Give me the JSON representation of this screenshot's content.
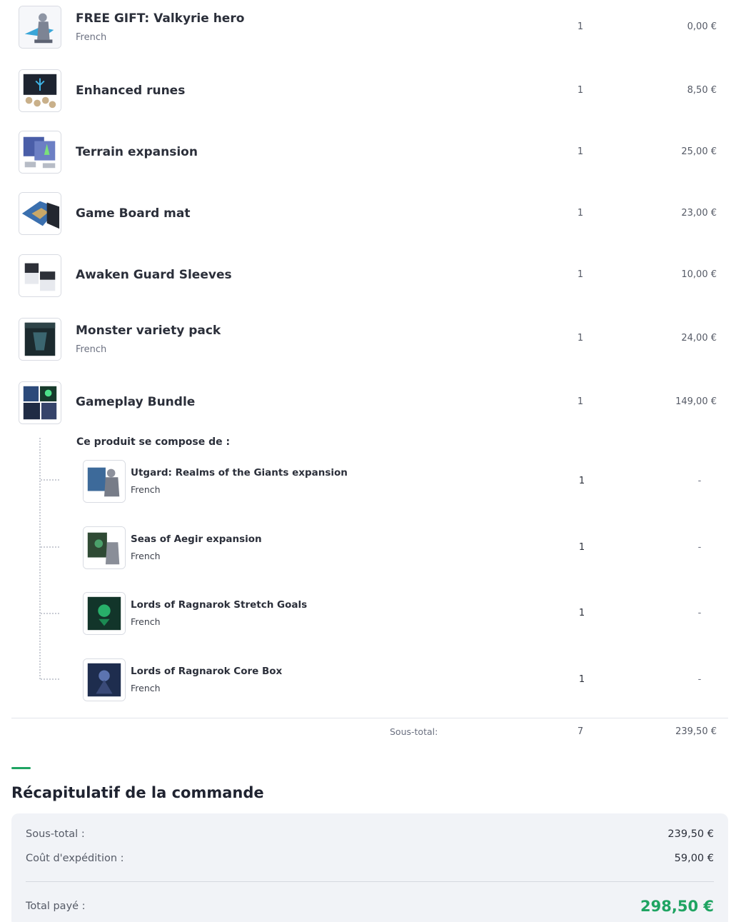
{
  "items": [
    {
      "name": "FREE GIFT: Valkyrie hero",
      "sub": "French",
      "qty": "1",
      "price": "0,00 €",
      "icon": "valkyrie-figure-icon"
    },
    {
      "name": "Enhanced runes",
      "sub": "",
      "qty": "1",
      "price": "8,50 €",
      "icon": "runes-box-icon"
    },
    {
      "name": "Terrain expansion",
      "sub": "",
      "qty": "1",
      "price": "25,00 €",
      "icon": "terrain-box-icon"
    },
    {
      "name": "Game Board mat",
      "sub": "",
      "qty": "1",
      "price": "23,00 €",
      "icon": "board-mat-icon"
    },
    {
      "name": "Awaken Guard Sleeves",
      "sub": "",
      "qty": "1",
      "price": "10,00 €",
      "icon": "sleeves-icon"
    },
    {
      "name": "Monster variety pack",
      "sub": "French",
      "qty": "1",
      "price": "24,00 €",
      "icon": "monster-box-icon"
    },
    {
      "name": "Gameplay Bundle",
      "sub": "",
      "qty": "1",
      "price": "149,00 €",
      "icon": "bundle-box-icon"
    }
  ],
  "bundle": {
    "compose_label": "Ce produit se compose de :",
    "components": [
      {
        "name": "Utgard: Realms of the Giants expansion",
        "sub": "French",
        "qty": "1",
        "price": "-"
      },
      {
        "name": "Seas of Aegir expansion",
        "sub": "French",
        "qty": "1",
        "price": "-"
      },
      {
        "name": "Lords of Ragnarok Stretch Goals",
        "sub": "French",
        "qty": "1",
        "price": "-"
      },
      {
        "name": "Lords of Ragnarok Core Box",
        "sub": "French",
        "qty": "1",
        "price": "-"
      }
    ]
  },
  "subtotal_row": {
    "label": "Sous-total:",
    "qty": "7",
    "price": "239,50 €"
  },
  "recap": {
    "title": "Récapitulatif de la commande",
    "subtotal_label": "Sous-total :",
    "subtotal_value": "239,50 €",
    "shipping_label": "Coût d'expédition :",
    "shipping_value": "59,00 €",
    "total_label": "Total payé :",
    "total_value": "298,50 €"
  },
  "colors": {
    "accent": "#1fa462",
    "summary_bg": "#f1f3f7",
    "text": "#2b2f3a"
  }
}
